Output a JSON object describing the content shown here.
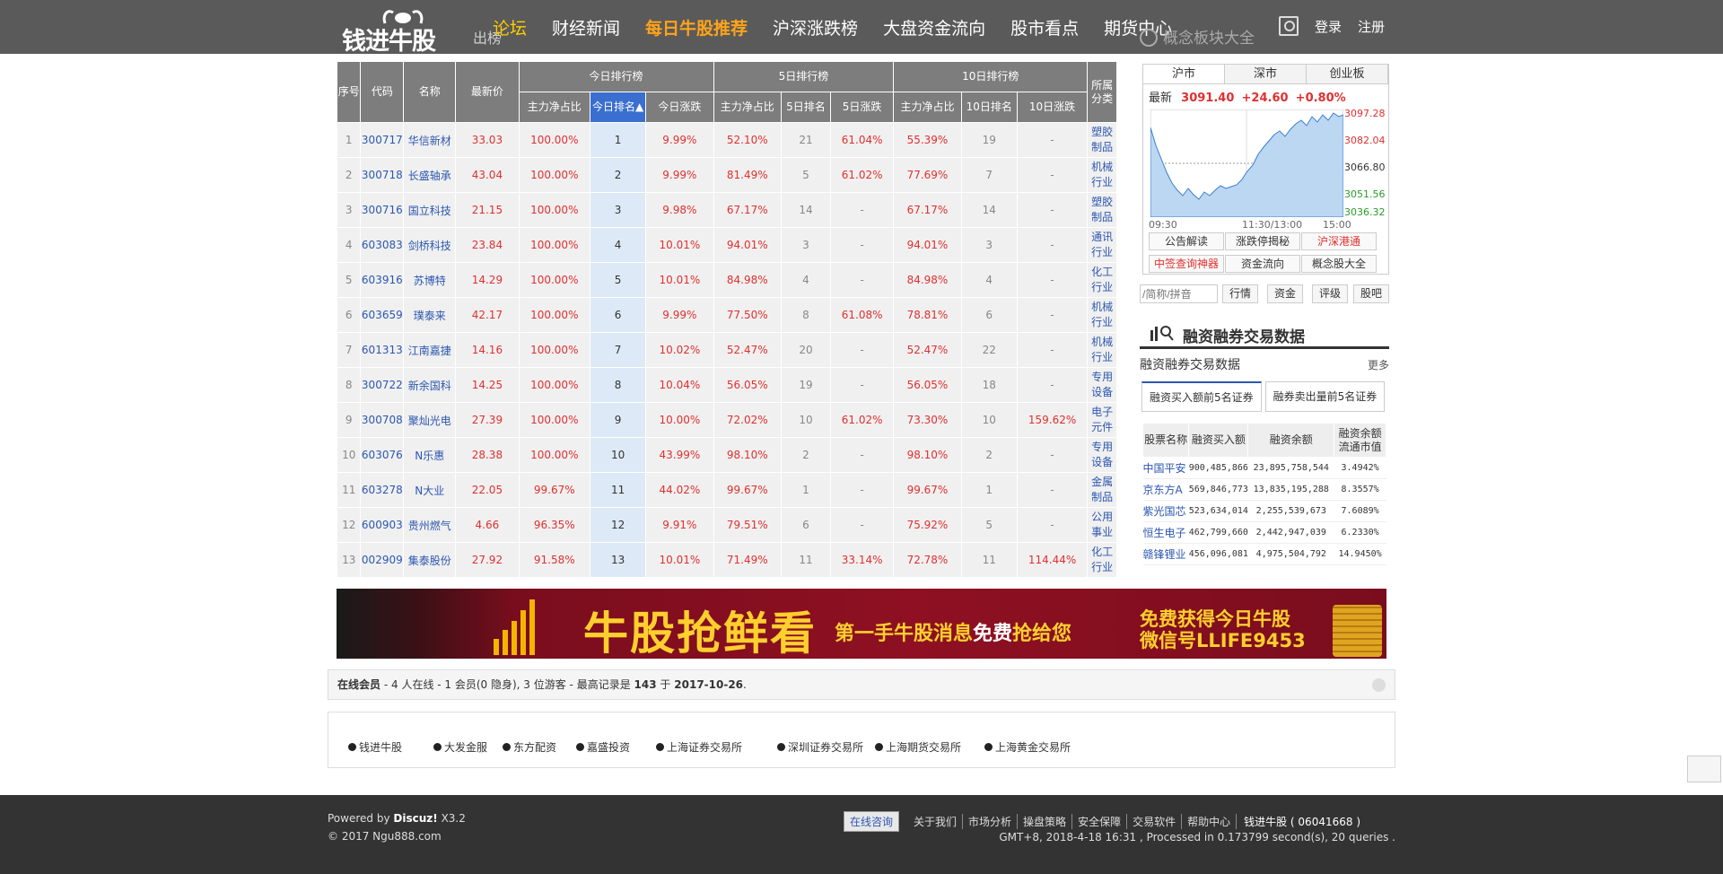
{
  "nav": {
    "logo": "钱进牛股",
    "bg_title": "出榜",
    "items": [
      "论坛",
      "财经新闻",
      "每日牛股推荐",
      "沪深涨跌榜",
      "大盘资金流向",
      "股市看点",
      "期货中心"
    ],
    "login": "登录",
    "register": "注册",
    "right_title": "概念板块大全"
  },
  "table": {
    "headers": {
      "seq": "序号",
      "code": "代码",
      "name": "名称",
      "price": "最新价",
      "g1": "今日排行榜",
      "g2": "5日排行榜",
      "g3": "10日排行榜",
      "cat": "所属分类",
      "net": "主力净占比",
      "rank_today": "今日排名▲",
      "chg_today": "今日涨跌",
      "rank5": "5日排名",
      "chg5": "5日涨跌",
      "rank10": "10日排名",
      "chg10": "10日涨跌"
    },
    "rows": [
      [
        "1",
        "300717",
        "华信新材",
        "33.03",
        "100.00%",
        "1",
        "9.99%",
        "52.10%",
        "21",
        "61.04%",
        "55.39%",
        "19",
        "-",
        "塑胶制品"
      ],
      [
        "2",
        "300718",
        "长盛轴承",
        "43.04",
        "100.00%",
        "2",
        "9.99%",
        "81.49%",
        "5",
        "61.02%",
        "77.69%",
        "7",
        "-",
        "机械行业"
      ],
      [
        "3",
        "300716",
        "国立科技",
        "21.15",
        "100.00%",
        "3",
        "9.98%",
        "67.17%",
        "14",
        "-",
        "67.17%",
        "14",
        "-",
        "塑胶制品"
      ],
      [
        "4",
        "603083",
        "剑桥科技",
        "23.84",
        "100.00%",
        "4",
        "10.01%",
        "94.01%",
        "3",
        "-",
        "94.01%",
        "3",
        "-",
        "通讯行业"
      ],
      [
        "5",
        "603916",
        "苏博特",
        "14.29",
        "100.00%",
        "5",
        "10.01%",
        "84.98%",
        "4",
        "-",
        "84.98%",
        "4",
        "-",
        "化工行业"
      ],
      [
        "6",
        "603659",
        "璞泰来",
        "42.17",
        "100.00%",
        "6",
        "9.99%",
        "77.50%",
        "8",
        "61.08%",
        "78.81%",
        "6",
        "-",
        "机械行业"
      ],
      [
        "7",
        "601313",
        "江南嘉捷",
        "14.16",
        "100.00%",
        "7",
        "10.02%",
        "52.47%",
        "20",
        "-",
        "52.47%",
        "22",
        "-",
        "机械行业"
      ],
      [
        "8",
        "300722",
        "新余国科",
        "14.25",
        "100.00%",
        "8",
        "10.04%",
        "56.05%",
        "19",
        "-",
        "56.05%",
        "18",
        "-",
        "专用设备"
      ],
      [
        "9",
        "300708",
        "聚灿光电",
        "27.39",
        "100.00%",
        "9",
        "10.00%",
        "72.02%",
        "10",
        "61.02%",
        "73.30%",
        "10",
        "159.62%",
        "电子元件"
      ],
      [
        "10",
        "603076",
        "N乐惠",
        "28.38",
        "100.00%",
        "10",
        "43.99%",
        "98.10%",
        "2",
        "-",
        "98.10%",
        "2",
        "-",
        "专用设备"
      ],
      [
        "11",
        "603278",
        "N大业",
        "22.05",
        "99.67%",
        "11",
        "44.02%",
        "99.67%",
        "1",
        "-",
        "99.67%",
        "1",
        "-",
        "金属制品"
      ],
      [
        "12",
        "600903",
        "贵州燃气",
        "4.66",
        "96.35%",
        "12",
        "9.91%",
        "79.51%",
        "6",
        "-",
        "75.92%",
        "5",
        "-",
        "公用事业"
      ],
      [
        "13",
        "002909",
        "集泰股份",
        "27.92",
        "91.58%",
        "13",
        "10.01%",
        "71.49%",
        "11",
        "33.14%",
        "72.78%",
        "11",
        "114.44%",
        "化工行业"
      ]
    ]
  },
  "index": {
    "tabs": [
      "沪市",
      "深市",
      "创业板"
    ],
    "label": "最新",
    "value": "3091.40",
    "change": "+24.60",
    "pct": "+0.80%",
    "y_labels": [
      "3097.28",
      "3082.04",
      "3066.80",
      "3051.56",
      "3036.32"
    ],
    "x_labels": [
      "09:30",
      "11:30/13:00",
      "15:00"
    ],
    "buttons": [
      "公告解读",
      "涨跌停揭秘",
      "沪深港通",
      "中签查询神器",
      "资金流向",
      "概念股大全"
    ],
    "search_placeholder": "/简称/拼音",
    "search_buttons": [
      "行情",
      "资金",
      "评级",
      "股吧"
    ]
  },
  "margin": {
    "title": "融资融券交易数据",
    "subtitle": "融资融券交易数据",
    "more": "更多",
    "tabs": [
      "融资买入额前5名证券",
      "融券卖出量前5名证券"
    ],
    "headers": [
      "股票名称",
      "融资买入额",
      "融资余额",
      "融资余额流通市值"
    ],
    "rows": [
      [
        "中国平安",
        "900,485,866",
        "23,895,758,544",
        "3.4942%"
      ],
      [
        "京东方A",
        "569,846,773",
        "13,835,195,288",
        "8.3557%"
      ],
      [
        "紫光国芯",
        "523,634,014",
        "2,255,539,673",
        "7.6089%"
      ],
      [
        "恒生电子",
        "462,799,660",
        "2,442,947,039",
        "6.2330%"
      ],
      [
        "赣锋锂业",
        "456,096,081",
        "4,975,504,792",
        "14.9450%"
      ]
    ]
  },
  "banner": {
    "big": "牛股抢鲜看",
    "sub1": "第一手牛股消息",
    "sub2": "免费",
    "sub3": "抢给您",
    "r1": "免费获得今日牛股",
    "r2": "微信号LLIFE9453"
  },
  "online": {
    "label": "在线会员",
    "text1": "- 4 人在线 - 1 会员(0 隐身), 3 位游客 - 最高记录是",
    "max": "143",
    "text2": "于",
    "date": "2017-10-26",
    "end": "."
  },
  "links": [
    "钱进牛股",
    "大发金服",
    "东方配资",
    "嘉盛投资",
    "上海证券交易所",
    "深圳证券交易所",
    "上海期货交易所",
    "上海黄金交易所"
  ],
  "footer": {
    "powered": "Powered by",
    "discuz": "Discuz!",
    "ver": "X3.2",
    "copy": "© 2017 Ngu888.com",
    "consult": "在线咨询",
    "links": [
      "关于我们",
      "市场分析",
      "操盘策略",
      "安全保障",
      "交易软件",
      "帮助中心"
    ],
    "site": "钱进牛股 ( 06041668 )",
    "stats": "GMT+8, 2018-4-18 16:31 , Processed in 0.173799 second(s), 20 queries ."
  },
  "colors": {
    "up": "#e03030",
    "link": "#2c57b0",
    "header": "#7d7d7d",
    "selected": "#3a6fd0",
    "topbar": "#5a5a5a"
  }
}
